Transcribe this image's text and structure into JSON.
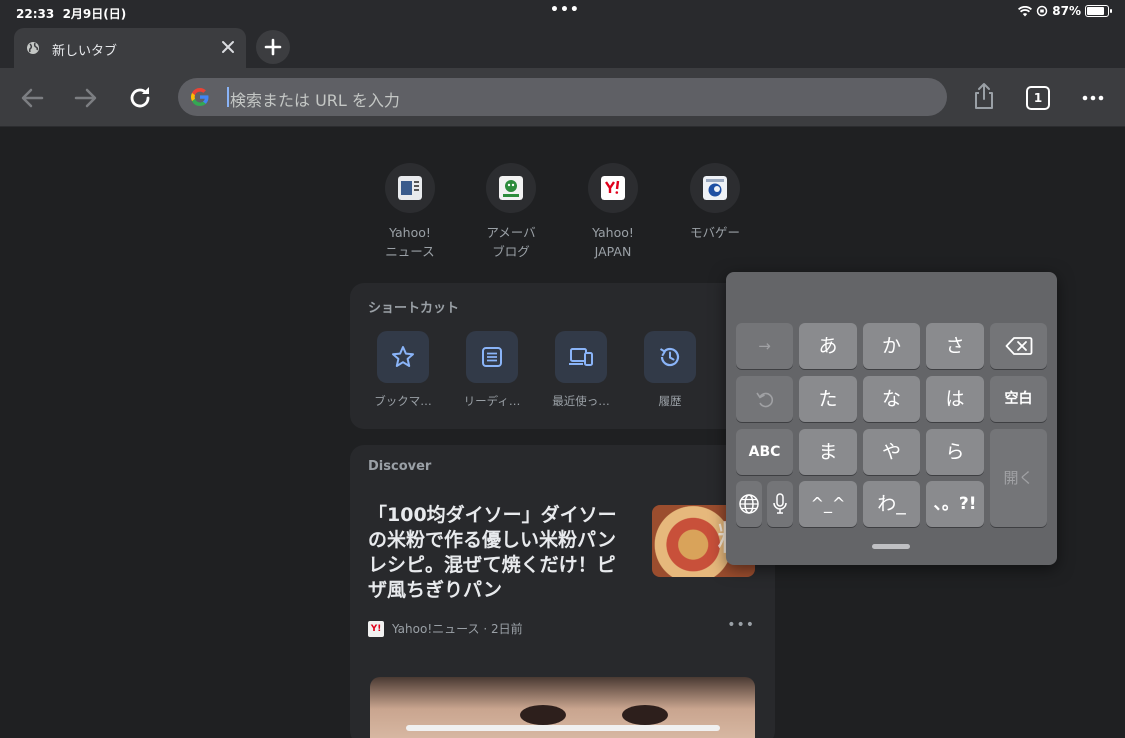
{
  "status": {
    "time": "22:33",
    "date": "2月9日(日)",
    "battery": "87%",
    "battery_level": 0.87,
    "dots": "•••"
  },
  "tab": {
    "title": "新しいタブ"
  },
  "toolbar": {
    "omnibox_placeholder": "検索または URL を入力",
    "tab_count": "1"
  },
  "most_visited": [
    {
      "line1": "Yahoo!",
      "line2": "ニュース"
    },
    {
      "line1": "アメーバ",
      "line2": "ブログ"
    },
    {
      "line1": "Yahoo!",
      "line2": "JAPAN"
    },
    {
      "line1": "モバゲー",
      "line2": ""
    }
  ],
  "shortcuts": {
    "title": "ショートカット",
    "items": [
      {
        "label": "ブックマ…",
        "icon": "star-icon"
      },
      {
        "label": "リーディ…",
        "icon": "reading-list-icon"
      },
      {
        "label": "最近使っ…",
        "icon": "devices-icon"
      },
      {
        "label": "履歴",
        "icon": "history-icon"
      }
    ]
  },
  "discover": {
    "title": "Discover",
    "headline": "「100均ダイソー」ダイソーの米粉で作る優しい米粉パンレシピ。混ぜて焼くだけ！ピザ風ちぎりパン",
    "thumb_text": "粉",
    "source": "Yahoo!ニュース · 2日前",
    "source_icon_text": "Y!",
    "more": "•••"
  },
  "keyboard": {
    "row1": [
      "→",
      "あ",
      "か",
      "さ"
    ],
    "row2": [
      "た",
      "な",
      "は",
      "空白"
    ],
    "row3": [
      "ABC",
      "ま",
      "や",
      "ら"
    ],
    "row4": [
      "^_^",
      "わ_",
      "、。?!"
    ],
    "open": "開く"
  }
}
